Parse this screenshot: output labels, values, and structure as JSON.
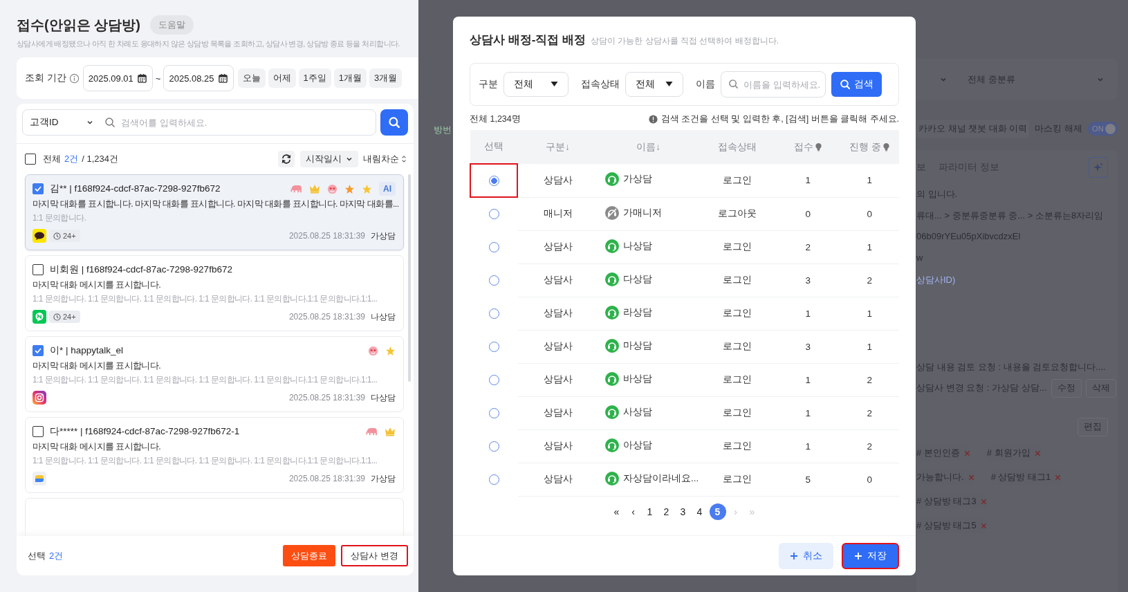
{
  "page": {
    "title": "접수(안읽은 상담방)",
    "help_button": "도움말",
    "description": "상담사에게 배정됐으나 아직 한 차례도 응대하지 않은 상담방 목록을 조회하고, 상담사 변경, 상담방 종료 등을 처리합니다."
  },
  "period": {
    "label": "조회 기간",
    "start": "2025.09.01",
    "separator": "~",
    "end": "2025.08.25",
    "quick_buttons": [
      "오늘",
      "어제",
      "1주일",
      "1개월",
      "3개월"
    ]
  },
  "search": {
    "field": "고객ID",
    "placeholder": "검색어를 입력하세요."
  },
  "list_header": {
    "checked": false,
    "all_label": "전체",
    "selected_count": "2건",
    "total": "/ 1,234건",
    "sort_field": "시작일시",
    "sort_order": "내림차순"
  },
  "rooms": [
    {
      "checked": true,
      "selected": true,
      "title": "김** | f168f924-cdcf-87ac-7298-927fb672",
      "tags": [
        {
          "kind": "elephant"
        },
        {
          "kind": "crown"
        },
        {
          "kind": "face"
        },
        {
          "kind": "star",
          "color": "#f79a2b"
        },
        {
          "kind": "star",
          "color": "#f7c531"
        },
        {
          "kind": "ai",
          "label": "AI"
        }
      ],
      "message": "마지막 대화를 표시합니다.  마지막 대화를 표시합니다. 마지막 대화를 표시합니다. 마지막 대화를...",
      "inquiry": "1:1 문의합니다.",
      "channel": {
        "kind": "kakao"
      },
      "wait": "24+",
      "time": "2025.08.25 18:31:39",
      "agent": "가상담"
    },
    {
      "checked": false,
      "selected": false,
      "title": "비회원 | f168f924-cdcf-87ac-7298-927fb672",
      "message": "마지막 대화 메시지를 표시합니다.",
      "inquiry": "1:1 문의합니다. 1:1 문의합니다. 1:1 문의합니다. 1:1 문의합니다. 1:1 문의합니다.1:1 문의합니다.1:1...",
      "channel": {
        "kind": "line"
      },
      "wait": "24+",
      "time": "2025.08.25 18:31:39",
      "agent": "나상담"
    },
    {
      "checked": true,
      "selected": false,
      "title": "이* | happytalk_el",
      "tags": [
        {
          "kind": "face"
        },
        {
          "kind": "star",
          "color": "#f7c531"
        }
      ],
      "message": "마지막 대화 메시지를 표시합니다.",
      "inquiry": "1:1 문의합니다. 1:1 문의합니다. 1:1 문의합니다. 1:1 문의합니다. 1:1 문의합니다.1:1 문의합니다.1:1...",
      "channel": {
        "kind": "instagram"
      },
      "time": "2025.08.25 18:31:39",
      "agent": "다상담"
    },
    {
      "checked": false,
      "selected": false,
      "title": "다***** | f168f924-cdcf-87ac-7298-927fb672-1",
      "tags": [
        {
          "kind": "elephant"
        },
        {
          "kind": "crown"
        }
      ],
      "message": "마지막 대화 메시지를 표시합니다.",
      "inquiry": "1:1 문의합니다. 1:1 문의합니다. 1:1 문의합니다. 1:1 문의합니다. 1:1 문의합니다.1:1 문의합니다.1:1...",
      "channel": {
        "kind": "chat"
      },
      "time": "2025.08.25 18:31:39",
      "agent": "가상담"
    }
  ],
  "footer": {
    "selected_label": "선택",
    "selected_count": "2건",
    "buttons": [
      {
        "label": "상담종료",
        "kind": "danger",
        "highlighted": false
      },
      {
        "label": "상담사 변경",
        "kind": "outline",
        "highlighted": true
      }
    ]
  },
  "background_page": {
    "cut_label": "방번",
    "category_select": "전체 중분류",
    "history_button": "카카오 채널 챗봇 대화 이력",
    "masking_label": "마스킹 해제",
    "masking_toggle": {
      "label": "ON",
      "on": true
    },
    "tab_labels": [
      "보",
      "파라미터 정보"
    ],
    "info_lines": [
      {
        "text": "의 입니다.",
        "kind": "plain"
      },
      {
        "text": "류대... > 중분류중분류 중... > 소분류는8자리임",
        "kind": "plain"
      },
      {
        "text": "06b09rYEu05pXibvcdzxEl",
        "kind": "plain"
      },
      {
        "text": "w",
        "kind": "plain"
      },
      {
        "text": "상담사ID)",
        "kind": "link"
      }
    ],
    "requests": [
      {
        "text": "상담 내용 검토 요청 : 내용을 검토요청합니다...."
      },
      {
        "text": "상담사 변경 요청 : 가상담 상담...",
        "actions": [
          "수정",
          "삭제"
        ]
      }
    ],
    "edit_button": "편집",
    "tag_rows": [
      [
        "# 본인인증",
        "# 회원가입"
      ],
      [
        "가능합니다.",
        "# 상담방 태그1"
      ],
      [
        "# 상담방 태그3"
      ],
      [
        "# 상담방 태그5"
      ]
    ]
  },
  "modal": {
    "title": "상담사 배정-직접 배정",
    "subtitle": "상담이 가능한 상담사를 직접 선택하여 배정합니다.",
    "filters": [
      {
        "kind": "select",
        "label": "구분",
        "value": "전체"
      },
      {
        "kind": "select",
        "label": "접속상태",
        "value": "전체"
      },
      {
        "kind": "input",
        "label": "이름",
        "placeholder": "이름을 입력하세요."
      }
    ],
    "search_button": "검색",
    "count": "전체 1,234명",
    "notice": "검색 조건을 선택 및 입력한 후, [검색] 버튼을 클릭해 주세요.",
    "columns": [
      {
        "label": "선택",
        "hint": false
      },
      {
        "label": "구분↓",
        "hint": false
      },
      {
        "label": "이름↓",
        "hint": false
      },
      {
        "label": "접속상태",
        "hint": false
      },
      {
        "label": "접수",
        "hint": true
      },
      {
        "label": "진행 중",
        "hint": true
      }
    ],
    "rows": [
      {
        "selected": true,
        "highlighted": true,
        "type": "상담사",
        "online": true,
        "name": "가상담",
        "status": "로그인",
        "received": "1",
        "in_progress": "1"
      },
      {
        "selected": false,
        "highlighted": false,
        "type": "매니저",
        "online": false,
        "name": "가매니저",
        "status": "로그아웃",
        "received": "0",
        "in_progress": "0"
      },
      {
        "selected": false,
        "highlighted": false,
        "type": "상담사",
        "online": true,
        "name": "나상담",
        "status": "로그인",
        "received": "2",
        "in_progress": "1"
      },
      {
        "selected": false,
        "highlighted": false,
        "type": "상담사",
        "online": true,
        "name": "다상담",
        "status": "로그인",
        "received": "3",
        "in_progress": "2"
      },
      {
        "selected": false,
        "highlighted": false,
        "type": "상담사",
        "online": true,
        "name": "라상담",
        "status": "로그인",
        "received": "1",
        "in_progress": "1"
      },
      {
        "selected": false,
        "highlighted": false,
        "type": "상담사",
        "online": true,
        "name": "마상담",
        "status": "로그인",
        "received": "3",
        "in_progress": "1"
      },
      {
        "selected": false,
        "highlighted": false,
        "type": "상담사",
        "online": true,
        "name": "바상담",
        "status": "로그인",
        "received": "1",
        "in_progress": "2"
      },
      {
        "selected": false,
        "highlighted": false,
        "type": "상담사",
        "online": true,
        "name": "사상담",
        "status": "로그인",
        "received": "1",
        "in_progress": "2"
      },
      {
        "selected": false,
        "highlighted": false,
        "type": "상담사",
        "online": true,
        "name": "아상담",
        "status": "로그인",
        "received": "1",
        "in_progress": "2"
      },
      {
        "selected": false,
        "highlighted": false,
        "type": "상담사",
        "online": true,
        "name": "자상담이라네요...",
        "status": "로그인",
        "received": "5",
        "in_progress": "0"
      }
    ],
    "pagination": [
      {
        "kind": "nav",
        "label": "«",
        "disabled": false
      },
      {
        "kind": "nav",
        "label": "‹",
        "disabled": false
      },
      {
        "kind": "page",
        "label": "1",
        "selected": false
      },
      {
        "kind": "page",
        "label": "2",
        "selected": false
      },
      {
        "kind": "page",
        "label": "3",
        "selected": false
      },
      {
        "kind": "page",
        "label": "4",
        "selected": false
      },
      {
        "kind": "page",
        "label": "5",
        "selected": true
      },
      {
        "kind": "nav",
        "label": "›",
        "disabled": true
      },
      {
        "kind": "nav",
        "label": "»",
        "disabled": true
      }
    ],
    "buttons": [
      {
        "label": "취소",
        "kind": "secondary",
        "highlighted": false
      },
      {
        "label": "저장",
        "kind": "primary",
        "highlighted": true
      }
    ]
  }
}
